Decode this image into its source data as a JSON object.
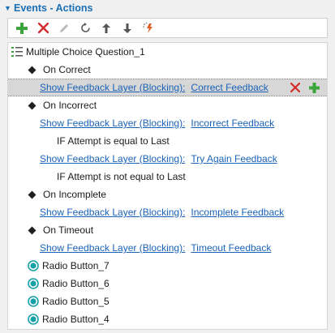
{
  "header": {
    "title": "Events - Actions",
    "caret": "▼"
  },
  "toolbar": {
    "buttons": [
      {
        "name": "add-icon"
      },
      {
        "name": "delete-icon"
      },
      {
        "name": "edit-icon"
      },
      {
        "name": "refresh-icon"
      },
      {
        "name": "move-up-icon"
      },
      {
        "name": "move-down-icon"
      },
      {
        "name": "magic-icon"
      }
    ]
  },
  "tree": {
    "root": "Multiple Choice Question_1",
    "events": {
      "on_correct": "On Correct",
      "on_incorrect": "On Incorrect",
      "on_incomplete": "On Incomplete",
      "on_timeout": "On Timeout"
    },
    "action_prefix": "Show Feedback Layer (Blocking):",
    "targets": {
      "correct": "Correct Feedback",
      "incorrect": "Incorrect Feedback",
      "try_again": "Try Again Feedback",
      "incomplete": "Incomplete Feedback",
      "timeout": "Timeout Feedback"
    },
    "conditions": {
      "equal": "IF Attempt is equal to Last",
      "not_equal": "IF Attempt is not equal to Last"
    },
    "radios": [
      "Radio Button_7",
      "Radio Button_6",
      "Radio Button_5",
      "Radio Button_4"
    ]
  },
  "colors": {
    "accent": "#1a6fb5",
    "link": "#1a62b8",
    "add_green": "#3aa63a",
    "delete_red": "#d42a2a",
    "radio_teal": "#17a0a8",
    "selected_bg": "#d7d7d7"
  }
}
